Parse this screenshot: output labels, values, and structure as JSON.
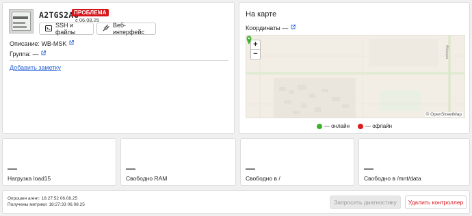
{
  "device": {
    "name": "A2TGS2AG",
    "status_badge": "ПРОБЛЕМА",
    "status_date": "с 06.08.25",
    "ssh_button": "SSH и файлы",
    "web_button": "Веб-интерфейс",
    "description_label": "Описание:",
    "description_value": "WB-MSK",
    "group_label": "Группа:",
    "group_value": "—",
    "add_note": "Добавить заметку",
    "status_color": "#d8141b"
  },
  "map": {
    "title": "На карте",
    "coords_label": "Координаты",
    "coords_value": "—",
    "zoom_in": "+",
    "zoom_out": "−",
    "attribution": "© OpenStreetMap",
    "street_label": "Фёдора",
    "legend": [
      {
        "label": "— онлайн",
        "color": "#3cb22b"
      },
      {
        "label": "— офлайн",
        "color": "#e01a1a"
      }
    ]
  },
  "metrics": [
    {
      "value": "—",
      "label": "Нагрузка load15"
    },
    {
      "value": "—",
      "label": "Свободно RAM"
    },
    {
      "value": "—",
      "label": "Свободно в /"
    },
    {
      "value": "—",
      "label": "Свободно в /mnt/data"
    }
  ],
  "footer": {
    "agent_polled": "Опрошен агент: 18:27:52 06.08.25",
    "metrics_received": "Получены метрики: 18:27:33 06.08.25",
    "diag_button": "Запросить диагностику",
    "delete_button": "Удалить контроллер"
  }
}
